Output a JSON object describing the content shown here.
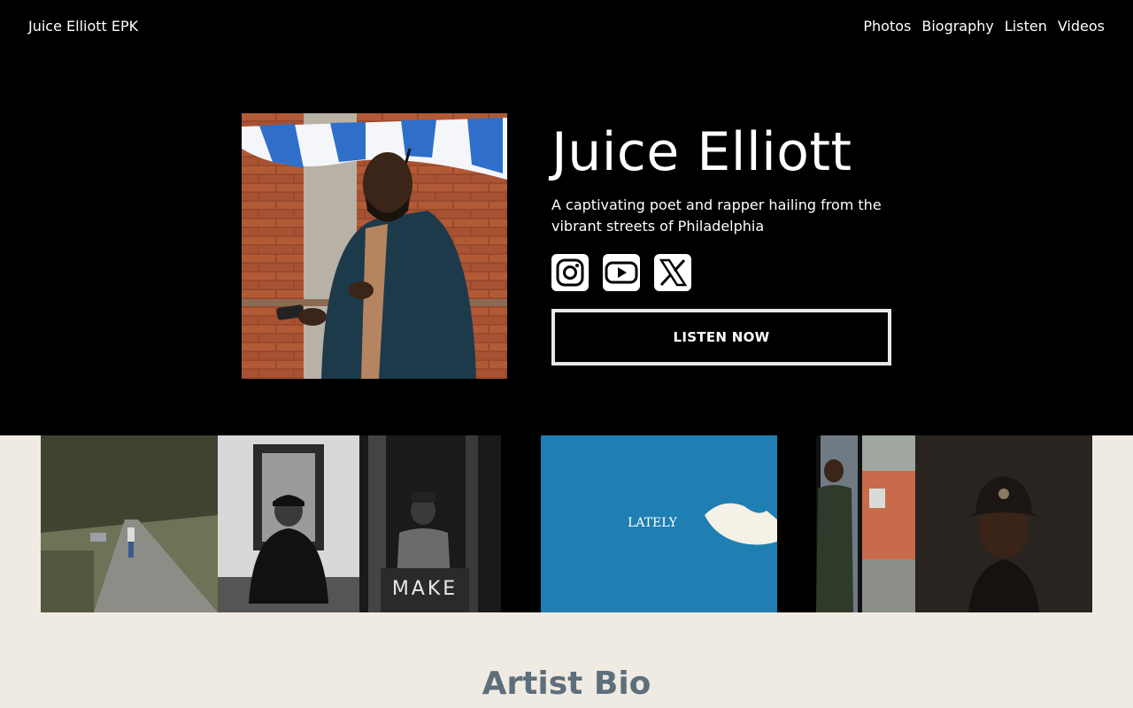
{
  "header": {
    "brand": "Juice Elliott EPK",
    "nav": [
      "Photos",
      "Biography",
      "Listen",
      "Videos"
    ]
  },
  "hero": {
    "name": "Juice Elliott",
    "tagline": "A captivating poet and rapper hailing from the vibrant streets of Philadelphia",
    "cta": "LISTEN NOW",
    "socials": [
      "instagram-icon",
      "youtube-icon",
      "x-icon"
    ]
  },
  "gallery": {
    "album_text": "LATELY",
    "sign_text": "MAKE"
  },
  "bio": {
    "title": "Artist Bio"
  },
  "colors": {
    "hero_bg": "#000000",
    "page_bg": "#efeae2",
    "bio_title": "#5e6f7c"
  }
}
